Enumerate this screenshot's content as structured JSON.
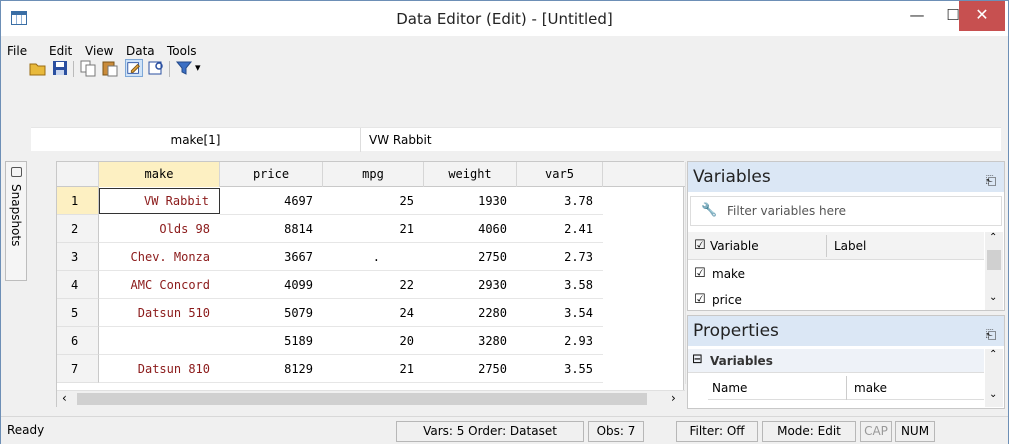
{
  "window": {
    "title": "Data Editor (Edit) - [Untitled]"
  },
  "menu": {
    "items": [
      "File",
      "Edit",
      "View",
      "Data",
      "Tools"
    ]
  },
  "editbar": {
    "cell_ref": "make[1]",
    "cell_value": "VW Rabbit"
  },
  "snapshots": {
    "label": "Snapshots"
  },
  "grid": {
    "columns": [
      "make",
      "price",
      "mpg",
      "weight",
      "var5"
    ],
    "rows": [
      {
        "n": "1",
        "make": "VW Rabbit",
        "price": "4697",
        "mpg": "25",
        "weight": "1930",
        "var5": "3.78"
      },
      {
        "n": "2",
        "make": "Olds 98",
        "price": "8814",
        "mpg": "21",
        "weight": "4060",
        "var5": "2.41"
      },
      {
        "n": "3",
        "make": "Chev. Monza",
        "price": "3667",
        "mpg": ".",
        "weight": "2750",
        "var5": "2.73"
      },
      {
        "n": "4",
        "make": "AMC Concord",
        "price": "4099",
        "mpg": "22",
        "weight": "2930",
        "var5": "3.58"
      },
      {
        "n": "5",
        "make": "Datsun 510",
        "price": "5079",
        "mpg": "24",
        "weight": "2280",
        "var5": "3.54"
      },
      {
        "n": "6",
        "make": "",
        "price": "5189",
        "mpg": "20",
        "weight": "3280",
        "var5": "2.93"
      },
      {
        "n": "7",
        "make": "Datsun 810",
        "price": "8129",
        "mpg": "21",
        "weight": "2750",
        "var5": "3.55"
      }
    ]
  },
  "variables": {
    "title": "Variables",
    "filter_placeholder": "Filter variables here",
    "col_variable": "Variable",
    "col_label": "Label",
    "items": [
      "make",
      "price"
    ]
  },
  "properties": {
    "title": "Properties",
    "section": "Variables",
    "name_key": "Name",
    "name_value": "make"
  },
  "status": {
    "ready": "Ready",
    "vars": "Vars: 5  Order: Dataset",
    "obs": "Obs: 7",
    "filter": "Filter: Off",
    "mode": "Mode: Edit",
    "cap": "CAP",
    "num": "NUM"
  },
  "colors": {
    "string_text": "#8b1a1a",
    "panel_header": "#dbe7f5",
    "close_button": "#c75050",
    "selected_header": "#fdf0c2"
  }
}
